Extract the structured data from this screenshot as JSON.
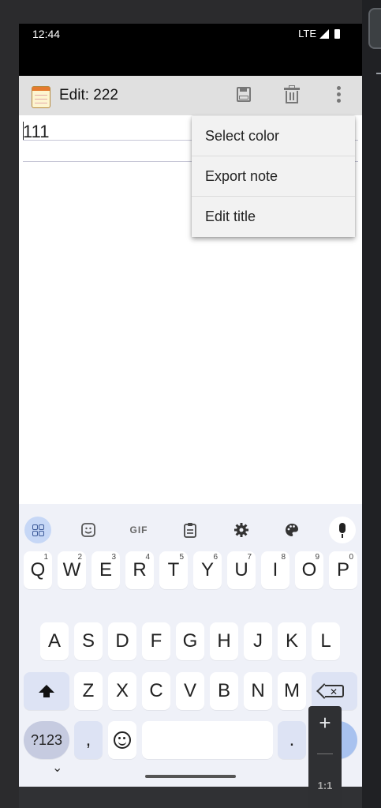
{
  "status_bar": {
    "time": "12:44",
    "network": "LTE"
  },
  "app_bar": {
    "title": "Edit: 222"
  },
  "note": {
    "content": "111"
  },
  "overflow_menu": {
    "items": [
      "Select color",
      "Export note",
      "Edit title"
    ]
  },
  "keyboard": {
    "toolbar": [
      "apps",
      "sticker",
      "GIF",
      "clipboard",
      "settings",
      "palette",
      "mic"
    ],
    "gif_label": "GIF",
    "row1": [
      {
        "key": "Q",
        "hint": "1"
      },
      {
        "key": "W",
        "hint": "2"
      },
      {
        "key": "E",
        "hint": "3"
      },
      {
        "key": "R",
        "hint": "4"
      },
      {
        "key": "T",
        "hint": "5"
      },
      {
        "key": "Y",
        "hint": "6"
      },
      {
        "key": "U",
        "hint": "7"
      },
      {
        "key": "I",
        "hint": "8"
      },
      {
        "key": "O",
        "hint": "9"
      },
      {
        "key": "P",
        "hint": "0"
      }
    ],
    "row2": [
      "A",
      "S",
      "D",
      "F",
      "G",
      "H",
      "J",
      "K",
      "L"
    ],
    "row3": [
      "Z",
      "X",
      "C",
      "V",
      "B",
      "N",
      "M"
    ],
    "bottom": {
      "symbols": "?123",
      "comma": ",",
      "period": "."
    }
  },
  "zoom_control": {
    "ratio": "1:1"
  },
  "colors": {
    "app_bar": "#e0e0e0",
    "keyboard_bg": "#eff1f8",
    "accent": "#a8c2ef"
  }
}
